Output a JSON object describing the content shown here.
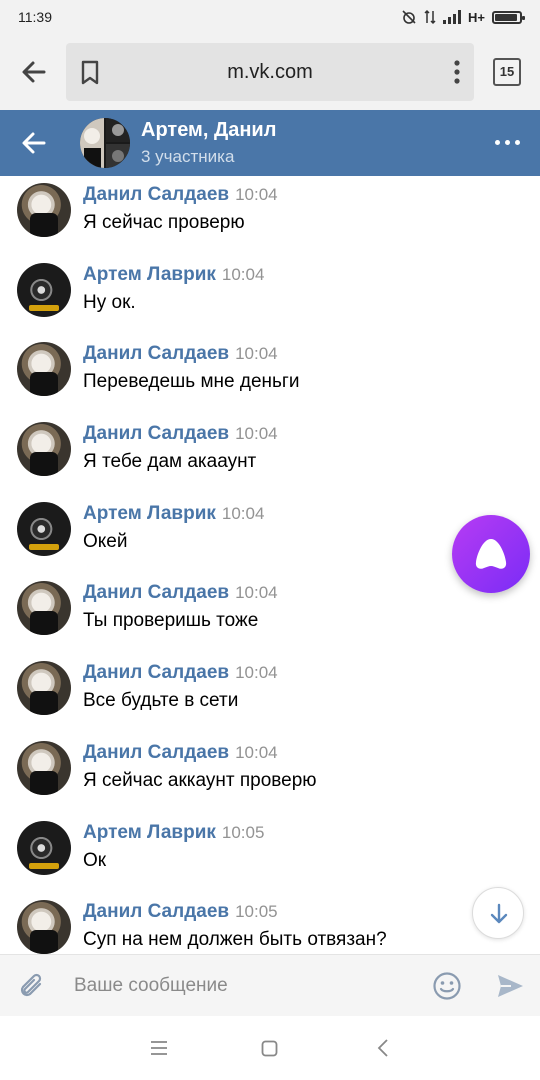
{
  "status_bar": {
    "time": "11:39",
    "network": "H+",
    "battery_level": 0.9
  },
  "browser": {
    "url": "m.vk.com",
    "tab_count": "15"
  },
  "chat": {
    "title": "Артем, Данил",
    "subtitle": "3 участника"
  },
  "messages": [
    {
      "author": "Данил Салдаев",
      "time": "10:04",
      "text": "Я сейчас проверю",
      "avatar": "cat-avatar"
    },
    {
      "author": "Артем Лаврик",
      "time": "10:04",
      "text": "Ну ок.",
      "avatar": "dark-avatar"
    },
    {
      "author": "Данил Салдаев",
      "time": "10:04",
      "text": "Переведешь мне деньги",
      "avatar": "cat-avatar"
    },
    {
      "author": "Данил Салдаев",
      "time": "10:04",
      "text": "Я тебе дам акааунт",
      "avatar": "cat-avatar"
    },
    {
      "author": "Артем Лаврик",
      "time": "10:04",
      "text": "Окей",
      "avatar": "dark-avatar"
    },
    {
      "author": "Данил Салдаев",
      "time": "10:04",
      "text": "Ты проверишь тоже",
      "avatar": "cat-avatar"
    },
    {
      "author": "Данил Салдаев",
      "time": "10:04",
      "text": "Все будьте в сети",
      "avatar": "cat-avatar"
    },
    {
      "author": "Данил Салдаев",
      "time": "10:04",
      "text": "Я сейчас аккаунт проверю",
      "avatar": "cat-avatar"
    },
    {
      "author": "Артем Лаврик",
      "time": "10:05",
      "text": "Ок",
      "avatar": "dark-avatar"
    },
    {
      "author": "Данил Салдаев",
      "time": "10:05",
      "text": "Суп на нем должен быть отвязан?",
      "avatar": "cat-avatar"
    }
  ],
  "composer": {
    "placeholder": "Ваше сообщение"
  },
  "colors": {
    "vk_blue": "#4a76a8",
    "name_blue": "#4a76a8",
    "time_gray": "#939393",
    "alice_purple": "#9b34f5"
  },
  "icons": [
    "back-arrow-icon",
    "bookmark-icon",
    "more-vert-icon",
    "tabs-icon",
    "more-horiz-icon",
    "paperclip-icon",
    "smile-icon",
    "send-icon",
    "scroll-down-icon",
    "alice-icon",
    "nav-menu-icon",
    "nav-home-icon",
    "nav-back-icon"
  ]
}
